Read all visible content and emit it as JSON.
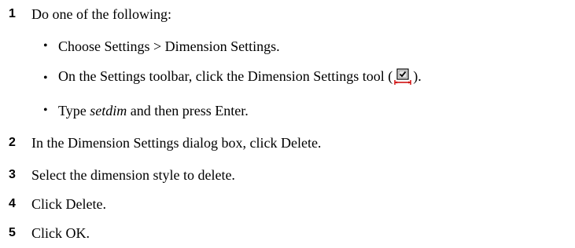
{
  "steps": [
    {
      "num": "1",
      "text": "Do one of the following:"
    },
    {
      "num": "2",
      "text": "In the Dimension Settings dialog box, click Delete."
    },
    {
      "num": "3",
      "text": "Select the dimension style to delete."
    },
    {
      "num": "4",
      "text": "Click Delete."
    },
    {
      "num": "5",
      "text": "Click OK."
    }
  ],
  "substeps": [
    {
      "bullet": "•",
      "text": "Choose Settings > Dimension Settings."
    },
    {
      "bullet": "•",
      "pre": "On the Settings toolbar, click the Dimension Settings tool (",
      "post": ")."
    },
    {
      "bullet": "•",
      "pre": "Type ",
      "command": "setdim",
      "post": " and then press Enter."
    }
  ],
  "icons": {
    "dimension_settings_tool": "dimension-settings-tool-icon"
  }
}
